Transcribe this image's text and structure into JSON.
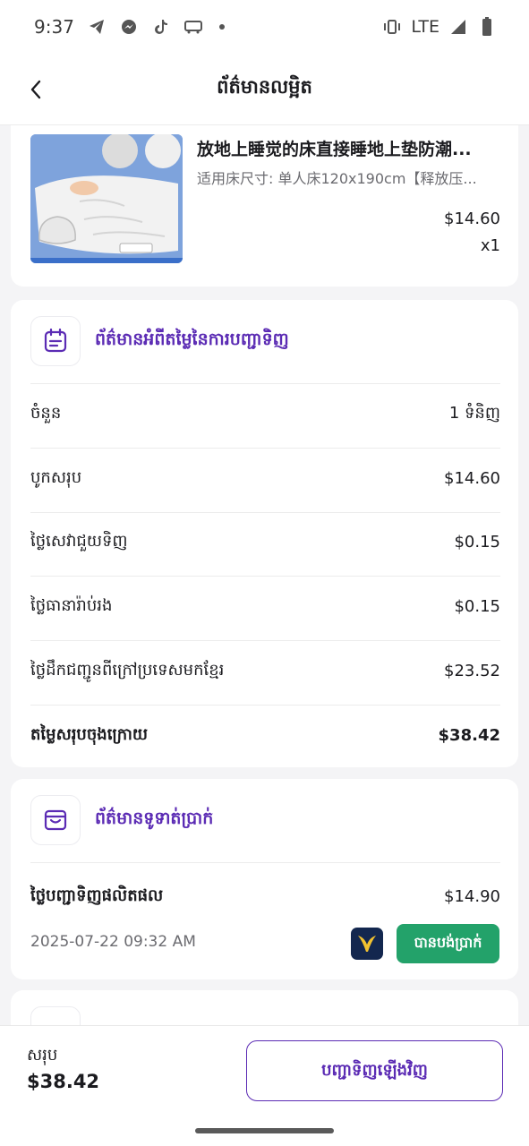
{
  "status_bar": {
    "time": "9:37",
    "network": "LTE",
    "icons": [
      "telegram-icon",
      "messenger-icon",
      "tiktok-icon",
      "bus-icon",
      "vibrate-icon",
      "signal-icon",
      "battery-icon"
    ]
  },
  "header": {
    "title": "ព័ត៌មានលម្អិត"
  },
  "product": {
    "title": "放地上睡觉的床直接睡地上垫防潮...",
    "variant": "适用床尺寸: 单人床120x190cm【释放压...",
    "price": "$14.60",
    "quantity": "x1"
  },
  "price_info": {
    "title": "ព័ត៌មានអំពីតម្លៃនៃការបញ្ជាទិញ",
    "rows": [
      {
        "label": "ចំនួន",
        "value": "1 ទំនិញ"
      },
      {
        "label": "បូកសរុប",
        "value": "$14.60"
      },
      {
        "label": "ថ្លៃសេវាជួយទិញ",
        "value": "$0.15"
      },
      {
        "label": "ថ្លៃធានារ៉ាប់រង",
        "value": "$0.15"
      },
      {
        "label": "ថ្លៃដឹកជញ្ជូនពីក្រៅប្រទេសមកខ្មែរ",
        "value": "$23.52"
      },
      {
        "label": "តម្លៃសរុបចុងក្រោយ",
        "value": "$38.42"
      }
    ]
  },
  "payment_info": {
    "title": "ព័ត៌មានទូទាត់ប្រាក់",
    "label": "ថ្លៃបញ្ជាទិញផលិតផល",
    "amount": "$14.90",
    "timestamp": "2025-07-22 09:32 AM",
    "status": "បានបង់ប្រាក់"
  },
  "bottom": {
    "total_label": "សរុប",
    "total_value": "$38.42",
    "reorder_label": "បញ្ជាទិញឡើងវិញ"
  },
  "colors": {
    "accent": "#5b2bb4",
    "paid": "#23a26a",
    "bank": "#13274f"
  }
}
